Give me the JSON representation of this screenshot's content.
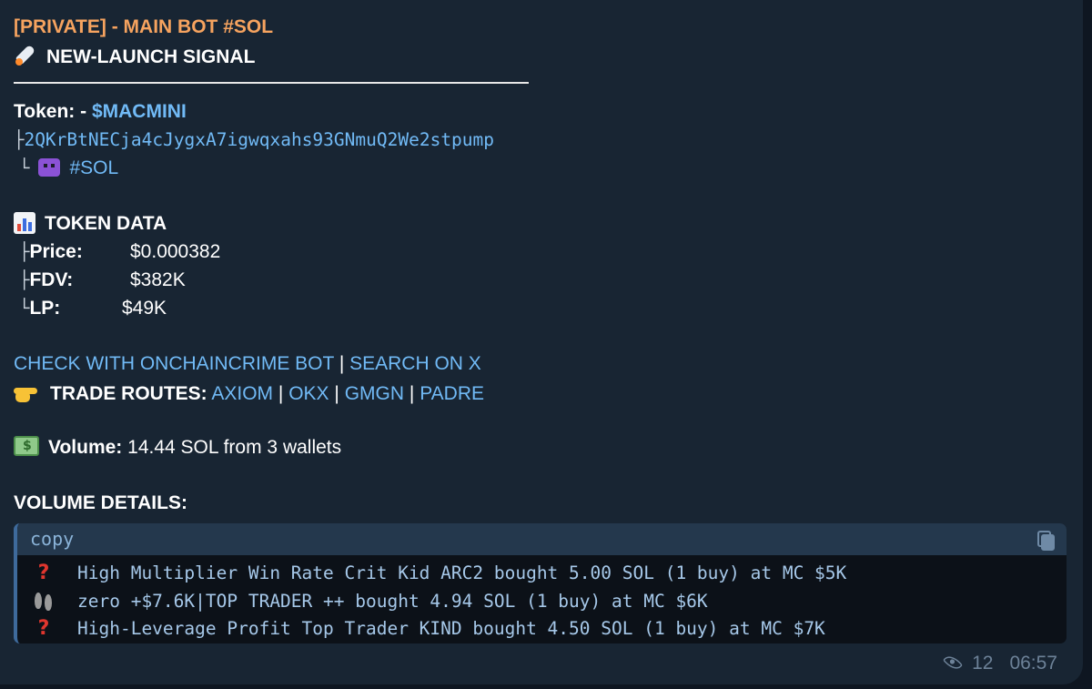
{
  "message": {
    "channel_title": "[PRIVATE] - MAIN BOT #SOL",
    "signal_title": "NEW-LAUNCH SIGNAL",
    "token_label": "Token:",
    "token_prefix": " - ",
    "token_symbol": "$MACMINI",
    "tree_branch": "├",
    "tree_end": "└",
    "contract_address": "2QKrBtNECja4cJygxA7igwqxahs93GNmuQ2We2stpump",
    "chain_tag": "#SOL",
    "token_data_title": "TOKEN DATA",
    "price_label": "Price:",
    "price_value": "$0.000382",
    "fdv_label": "FDV:",
    "fdv_value": "$382K",
    "lp_label": "LP:",
    "lp_value": "$49K",
    "check_link": "CHECK WITH ONCHAINCRIME BOT",
    "pipe": "|",
    "search_link": "SEARCH ON X",
    "trade_routes_label": "TRADE ROUTES:",
    "routes": [
      "AXIOM",
      "OKX",
      "GMGN",
      "PADRE"
    ],
    "volume_label": "Volume:",
    "volume_value": "14.44 SOL from 3 wallets",
    "volume_details_title": "VOLUME DETAILS:"
  },
  "code_block": {
    "language_label": "copy",
    "lines": [
      {
        "icon": "question-mark-icon",
        "text": "High Multiplier Win Rate Crit Kid ARC2 bought 5.00 SOL (1 buy) at MC $5K"
      },
      {
        "icon": "footprints-icon",
        "text": "zero +$7.6K|TOP TRADER ++ bought 4.94 SOL (1 buy) at MC $6K"
      },
      {
        "icon": "question-mark-icon",
        "text": "High-Leverage Profit Top Trader KIND bought 4.50 SOL (1 buy) at MC $7K"
      }
    ]
  },
  "footer": {
    "views": "12",
    "time": "06:57"
  },
  "colors": {
    "background": "#0e1621",
    "bubble": "#182533",
    "link": "#71baf6",
    "channel_title": "#f6a35f",
    "code_text": "#a6c8e9"
  }
}
